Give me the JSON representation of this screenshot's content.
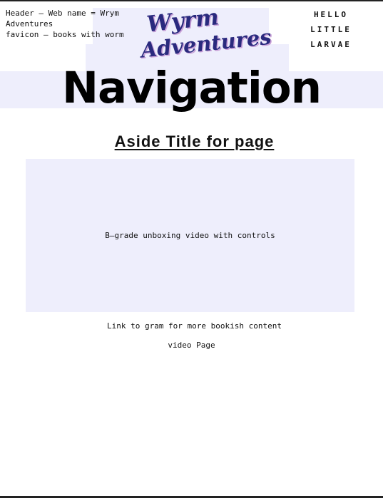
{
  "header": {
    "note": "Header – Web name = Wrym Adventures\nfavicon – books with worm",
    "logo_line1": "Wyrm",
    "logo_line2": "Adventures",
    "greeting": [
      "HELLO",
      "LITTLE",
      "LARVAE"
    ]
  },
  "nav": {
    "title": "Navigation"
  },
  "main": {
    "aside_title": "Aside Title for page",
    "video_placeholder": "B–grade unboxing video with controls",
    "link_text": "Link to gram for more bookish content",
    "page_label": "video Page"
  },
  "colors": {
    "panel": "#eeeefc",
    "logo": "#2a2a7e",
    "logo_shadow": "#c9a0d8"
  }
}
